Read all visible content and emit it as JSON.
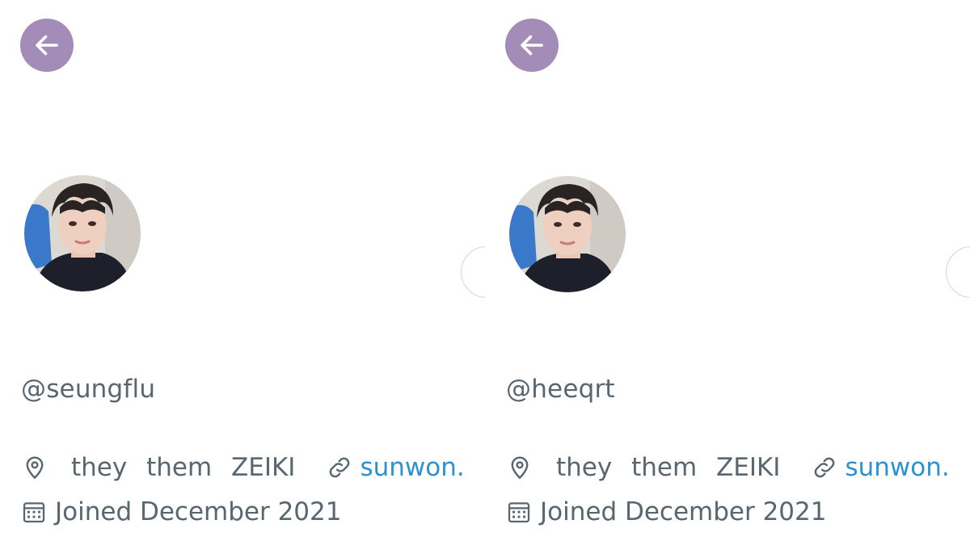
{
  "colors": {
    "back_button": "#a48cb8",
    "secondary_text": "#57666f",
    "link": "#2a92d1",
    "border": "#cfd6dc"
  },
  "panels": [
    {
      "handle": "@seungflu",
      "location": "they them ZEIKI",
      "link": "sunwon.",
      "joined": "Joined December 2021",
      "icons": {
        "back": "arrow-left-icon",
        "location": "map-pin-icon",
        "link": "link-icon",
        "joined": "calendar-icon"
      }
    },
    {
      "handle": "@heeqrt",
      "location": "they them ZEIKI",
      "link": "sunwon.",
      "joined": "Joined December 2021",
      "icons": {
        "back": "arrow-left-icon",
        "location": "map-pin-icon",
        "link": "link-icon",
        "joined": "calendar-icon"
      }
    }
  ]
}
